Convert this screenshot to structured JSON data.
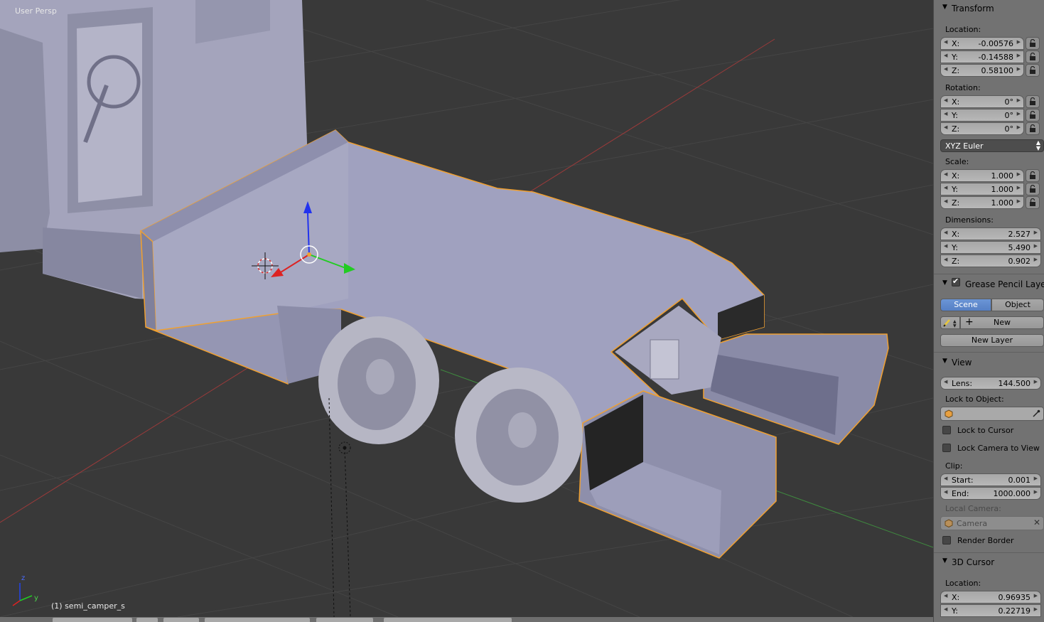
{
  "viewport": {
    "view_label": "User Persp",
    "object_label": "(1) semi_camper_s",
    "axis_z": "z",
    "axis_y": "y"
  },
  "colors": {
    "viewport_bg": "#393939",
    "grid_line": "#444444",
    "x_axis": "#9b3a3a",
    "y_axis": "#3f8a3f",
    "selection": "#f0a030",
    "mesh_face": "#9a9bbb",
    "panel_bg": "#727272",
    "button_active": "#5680c4"
  },
  "panel": {
    "transform": {
      "title": "Transform",
      "location_label": "Location:",
      "location": [
        {
          "axis": "X:",
          "value": "-0.00576"
        },
        {
          "axis": "Y:",
          "value": "-0.14588"
        },
        {
          "axis": "Z:",
          "value": "0.58100"
        }
      ],
      "rotation_label": "Rotation:",
      "rotation": [
        {
          "axis": "X:",
          "value": "0°"
        },
        {
          "axis": "Y:",
          "value": "0°"
        },
        {
          "axis": "Z:",
          "value": "0°"
        }
      ],
      "rotation_mode": "XYZ Euler",
      "scale_label": "Scale:",
      "scale": [
        {
          "axis": "X:",
          "value": "1.000"
        },
        {
          "axis": "Y:",
          "value": "1.000"
        },
        {
          "axis": "Z:",
          "value": "1.000"
        }
      ],
      "dimensions_label": "Dimensions:",
      "dimensions": [
        {
          "axis": "X:",
          "value": "2.527"
        },
        {
          "axis": "Y:",
          "value": "5.490"
        },
        {
          "axis": "Z:",
          "value": "0.902"
        }
      ]
    },
    "grease_pencil": {
      "title": "Grease Pencil Layers",
      "enabled": true,
      "scene_tab": "Scene",
      "object_tab": "Object",
      "new_label": "New",
      "new_layer_label": "New Layer"
    },
    "view": {
      "title": "View",
      "lens_label": "Lens:",
      "lens_value": "144.500",
      "lock_to_object_label": "Lock to Object:",
      "lock_to_cursor": "Lock to Cursor",
      "lock_camera": "Lock Camera to View",
      "clip_label": "Clip:",
      "clip_start_label": "Start:",
      "clip_start": "0.001",
      "clip_end_label": "End:",
      "clip_end": "1000.000",
      "local_camera_label": "Local Camera:",
      "local_camera": "Camera",
      "render_border": "Render Border"
    },
    "cursor": {
      "title": "3D Cursor",
      "location_label": "Location:",
      "location": [
        {
          "axis": "X:",
          "value": "0.96935"
        },
        {
          "axis": "Y:",
          "value": "0.22719"
        }
      ]
    }
  }
}
